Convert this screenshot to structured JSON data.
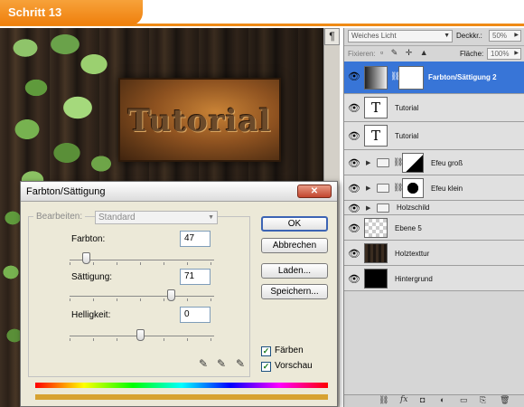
{
  "banner": {
    "title": "Schritt 13"
  },
  "canvas": {
    "sign_text": "Tutorial",
    "para_symbol": "¶"
  },
  "layers_panel": {
    "blend_mode": "Weiches Licht",
    "opacity_label": "Deckkr.:",
    "opacity_value": "50%",
    "lock_label": "Fixieren:",
    "fill_label": "Fläche:",
    "fill_value": "100%",
    "layers": [
      {
        "name": "Farbton/Sättigung 2",
        "selected": true
      },
      {
        "name": "Tutorial",
        "thumb": "T"
      },
      {
        "name": "Tutorial",
        "thumb": "T"
      },
      {
        "name": "Efeu groß"
      },
      {
        "name": "Efeu klein"
      },
      {
        "name": "Holzschild"
      },
      {
        "name": "Ebene 5"
      },
      {
        "name": "Holztexttur"
      },
      {
        "name": "Hintergrund"
      }
    ]
  },
  "dialog": {
    "title": "Farbton/Sättigung",
    "close_symbol": "✕",
    "edit_label": "Bearbeiten:",
    "edit_value": "Standard",
    "hue_label": "Farbton:",
    "hue_value": "47",
    "saturation_label": "Sättigung:",
    "saturation_value": "71",
    "lightness_label": "Helligkeit:",
    "lightness_value": "0",
    "buttons": {
      "ok": "OK",
      "cancel": "Abbrechen",
      "load": "Laden...",
      "save": "Speichern..."
    },
    "colorize_label": "Färben",
    "colorize_checked": true,
    "preview_label": "Vorschau",
    "preview_checked": true
  }
}
